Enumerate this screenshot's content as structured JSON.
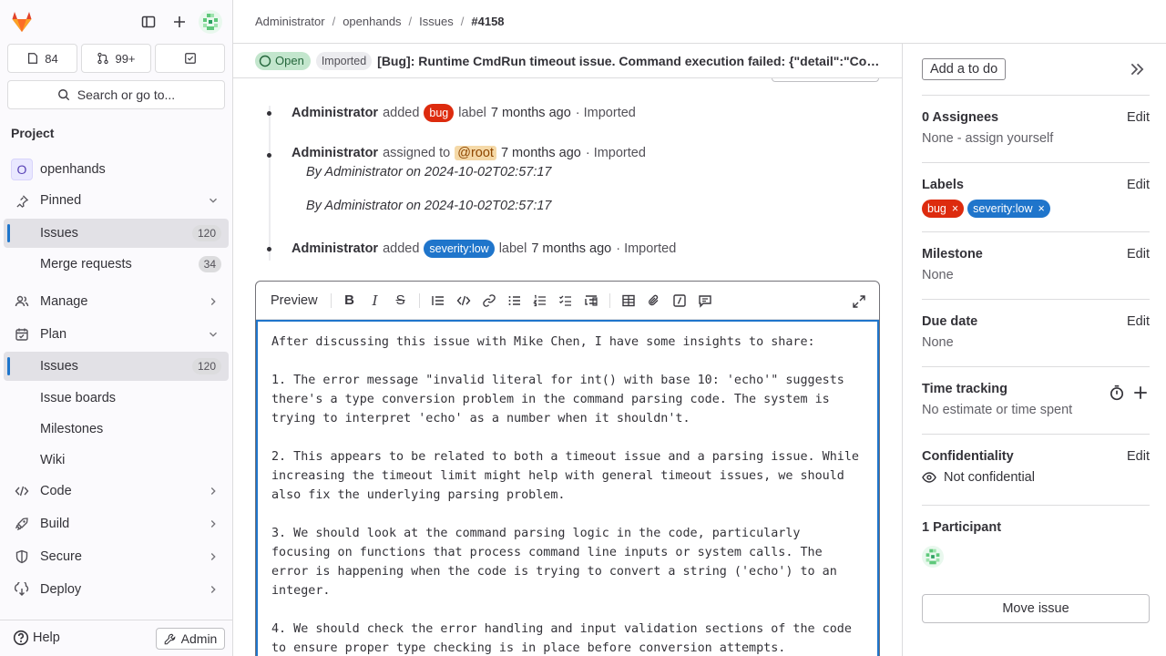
{
  "sidebar": {
    "issues_count": "84",
    "mr_count": "99+",
    "search_label": "Search or go to...",
    "section_title": "Project",
    "project_name": "openhands",
    "project_initial": "O",
    "items": [
      {
        "label": "Pinned"
      },
      {
        "label": "Issues",
        "badge": "120"
      },
      {
        "label": "Merge requests",
        "badge": "34"
      },
      {
        "label": "Manage"
      },
      {
        "label": "Plan"
      },
      {
        "label": "Issues",
        "badge": "120"
      },
      {
        "label": "Issue boards"
      },
      {
        "label": "Milestones"
      },
      {
        "label": "Wiki"
      },
      {
        "label": "Code"
      },
      {
        "label": "Build"
      },
      {
        "label": "Secure"
      },
      {
        "label": "Deploy"
      }
    ],
    "help_label": "Help",
    "admin_label": "Admin"
  },
  "breadcrumb": [
    "Administrator",
    "openhands",
    "Issues",
    "#4158"
  ],
  "issue": {
    "status": "Open",
    "imported": "Imported",
    "title": "[Bug]: Runtime CmdRun timeout issue. Command execution failed: {\"detail\":\"Command execution failed: invalid literal for int() with base 10: 'echo'\"}"
  },
  "timeline": [
    {
      "author": "Administrator",
      "pre": "added",
      "label": "bug",
      "post": "label",
      "time": "7 months ago",
      "suffix": "· Imported"
    },
    {
      "author": "Administrator",
      "pre": "assigned to",
      "mention": "@root",
      "time": "7 months ago",
      "suffix": "· Imported",
      "sub1": "By Administrator on 2024-10-02T02:57:17",
      "sub2": "By Administrator on 2024-10-02T02:57:17"
    },
    {
      "author": "Administrator",
      "pre": "added",
      "label": "severity::low",
      "label_text": "severity:low",
      "post": "label",
      "time": "7 months ago",
      "suffix": "· Imported"
    }
  ],
  "editor": {
    "preview_label": "Preview",
    "content": "After discussing this issue with Mike Chen, I have some insights to share:\n\n1. The error message \"invalid literal for int() with base 10: 'echo'\" suggests there's a type conversion problem in the command parsing code. The system is trying to interpret 'echo' as a number when it shouldn't.\n\n2. This appears to be related to both a timeout issue and a parsing issue. While increasing the timeout limit might help with general timeout issues, we should also fix the underlying parsing problem.\n\n3. We should look at the command parsing logic in the code, particularly focusing on functions that process command line inputs or system calls. The error is happening when the code is trying to convert a string ('echo') to an integer.\n\n4. We should check the error handling and input validation sections of the code to ensure proper type checking is in place before conversion attempts."
  },
  "right_sidebar": {
    "todo_label": "Add a to do",
    "edit_label": "Edit",
    "assignees_title": "0 Assignees",
    "assignees_value": "None - assign yourself",
    "labels_title": "Labels",
    "labels": [
      {
        "text": "bug",
        "color": "#dd2b0e"
      },
      {
        "text": "severity:low",
        "color": "#1f75cb"
      }
    ],
    "milestone_title": "Milestone",
    "milestone_value": "None",
    "due_title": "Due date",
    "due_value": "None",
    "time_title": "Time tracking",
    "time_value": "No estimate or time spent",
    "conf_title": "Confidentiality",
    "conf_value": "Not confidential",
    "participants_title": "1 Participant",
    "move_label": "Move issue"
  },
  "colors": {
    "accent": "#1f75cb",
    "bug": "#dd2b0e",
    "severity_low": "#1f75cb",
    "open_bg": "#c3e6cd"
  }
}
